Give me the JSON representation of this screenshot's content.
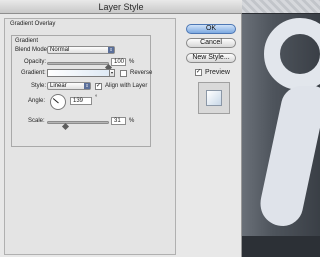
{
  "window": {
    "title": "Layer Style"
  },
  "panel": {
    "section_title": "Gradient Overlay",
    "group_title": "Gradient",
    "blend_mode": {
      "label": "Blend Mode:",
      "value": "Normal"
    },
    "opacity": {
      "label": "Opacity:",
      "value": "100",
      "unit": "%",
      "level": 1.0
    },
    "gradient": {
      "label": "Gradient:",
      "reverse_label": "Reverse",
      "reverse_checked": false
    },
    "style": {
      "label": "Style:",
      "value": "Linear",
      "align_label": "Align with Layer",
      "align_checked": true,
      "check_glyph": "✓"
    },
    "angle": {
      "label": "Angle:",
      "value": "139",
      "unit": "°"
    },
    "scale": {
      "label": "Scale:",
      "value": "31",
      "unit": "%",
      "level": 0.31
    }
  },
  "buttons": {
    "ok": "OK",
    "cancel": "Cancel",
    "new_style": "New Style..."
  },
  "preview": {
    "label": "Preview",
    "checked": true,
    "check_glyph": "✓"
  },
  "icons": {
    "select_arrow": "▾",
    "stepper_arrow": "⇕"
  },
  "colors": {
    "accent": "#5a6f9a",
    "default_button": "#7da9e1"
  }
}
